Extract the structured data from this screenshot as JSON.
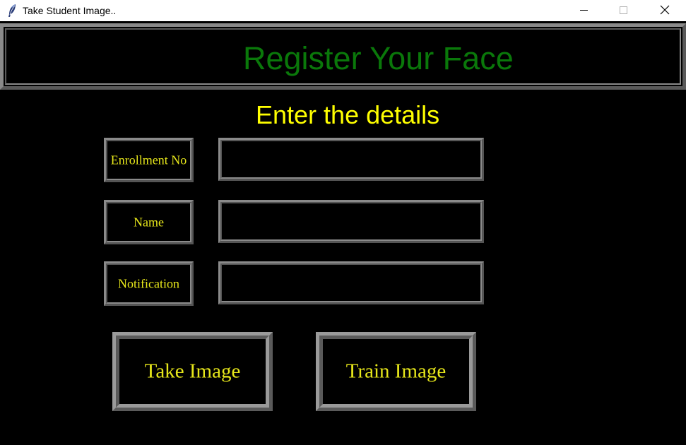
{
  "window": {
    "title": "Take Student Image..",
    "icon": "feather-icon"
  },
  "header": {
    "title": "Register Your Face",
    "title_color": "#0a780a"
  },
  "form": {
    "subtitle": "Enter the details",
    "fields": [
      {
        "label": "Enrollment No",
        "value": ""
      },
      {
        "label": "Name",
        "value": ""
      },
      {
        "label": "Notification",
        "value": ""
      }
    ]
  },
  "actions": {
    "take_image": "Take Image",
    "train_image": "Train Image"
  },
  "colors": {
    "background": "#000000",
    "label_text": "#e6e61a",
    "subtitle_text": "#ffff00",
    "border": "#8a8a8a"
  }
}
